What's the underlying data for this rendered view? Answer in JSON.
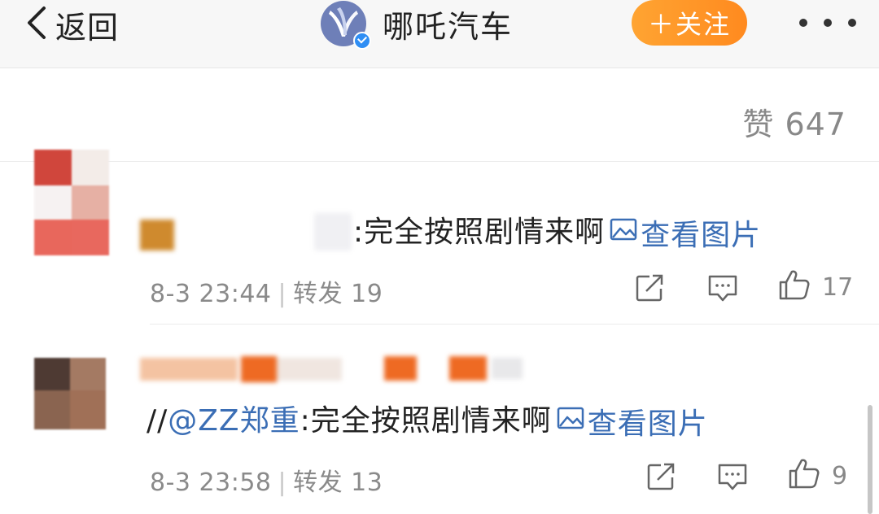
{
  "header": {
    "back_label": "返回",
    "brand_name": "哪吒汽车",
    "follow_label": "＋关注",
    "verified_color": "#2f8ef4",
    "follow_color": "#ff9c29"
  },
  "post": {
    "likes_label": "赞 647"
  },
  "reposts": [
    {
      "text": ":完全按照剧情来啊",
      "view_image": "查看图片",
      "time": "8-3 23:44",
      "repost_label": "转发 19",
      "like_count": "17"
    },
    {
      "prefix": "//",
      "mention": "@ZZ郑重",
      "text": ":完全按照剧情来啊",
      "view_image": "查看图片",
      "time": "8-3 23:58",
      "repost_label": "转发 13",
      "like_count": "9"
    }
  ],
  "icons": {
    "back": "chevron-left-icon",
    "logo": "nezha-logo",
    "more": "more-dots-icon",
    "image": "image-icon",
    "share": "share-icon",
    "comment": "comment-icon",
    "like": "thumbs-up-icon"
  }
}
